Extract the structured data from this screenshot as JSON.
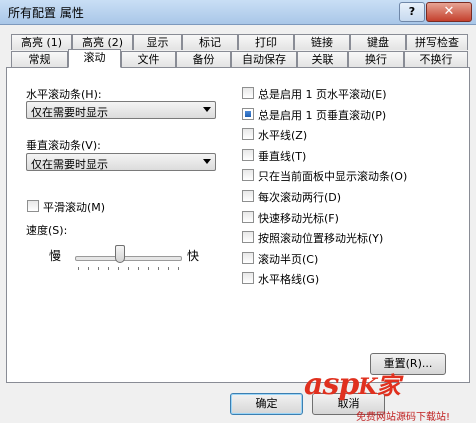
{
  "window": {
    "title": "所有配置 属性",
    "help_label": "?",
    "close_label": "✕"
  },
  "tabs_row1": [
    "高亮 (1)",
    "高亮 (2)",
    "显示",
    "标记",
    "打印",
    "链接",
    "键盘",
    "拼写检查"
  ],
  "tabs_row2": [
    "常规",
    "滚动",
    "文件",
    "备份",
    "自动保存",
    "关联",
    "换行",
    "不换行"
  ],
  "active_tab": "滚动",
  "left": {
    "hscroll_label": "水平滚动条(H):",
    "hscroll_value": "仅在需要时显示",
    "vscroll_label": "垂直滚动条(V):",
    "vscroll_value": "仅在需要时显示",
    "smooth_label": "平滑滚动(M)",
    "smooth_checked": false,
    "speed_label": "速度(S):",
    "slow_label": "慢",
    "fast_label": "快",
    "speed_level_fraction": 0.45
  },
  "options": [
    {
      "label": "总是启用 1 页水平滚动(E)",
      "checked": false
    },
    {
      "label": "总是启用 1 页垂直滚动(P)",
      "checked": true
    },
    {
      "label": "水平线(Z)",
      "checked": false
    },
    {
      "label": "垂直线(T)",
      "checked": false
    },
    {
      "label": "只在当前面板中显示滚动条(O)",
      "checked": false
    },
    {
      "label": "每次滚动两行(D)",
      "checked": false
    },
    {
      "label": "快速移动光标(F)",
      "checked": false
    },
    {
      "label": "按照滚动位置移动光标(Y)",
      "checked": false
    },
    {
      "label": "滚动半页(C)",
      "checked": false
    },
    {
      "label": "水平格线(G)",
      "checked": false
    }
  ],
  "buttons": {
    "reset": "重置(R)...",
    "ok": "确定",
    "cancel": "取消"
  },
  "watermark": {
    "brand": "asp",
    "brand2": "K",
    "brand3": "家",
    "sub": "免费网站源码下载站!"
  },
  "colors": {
    "accent": "#1e5fb3",
    "watermark": "#e0301e"
  }
}
